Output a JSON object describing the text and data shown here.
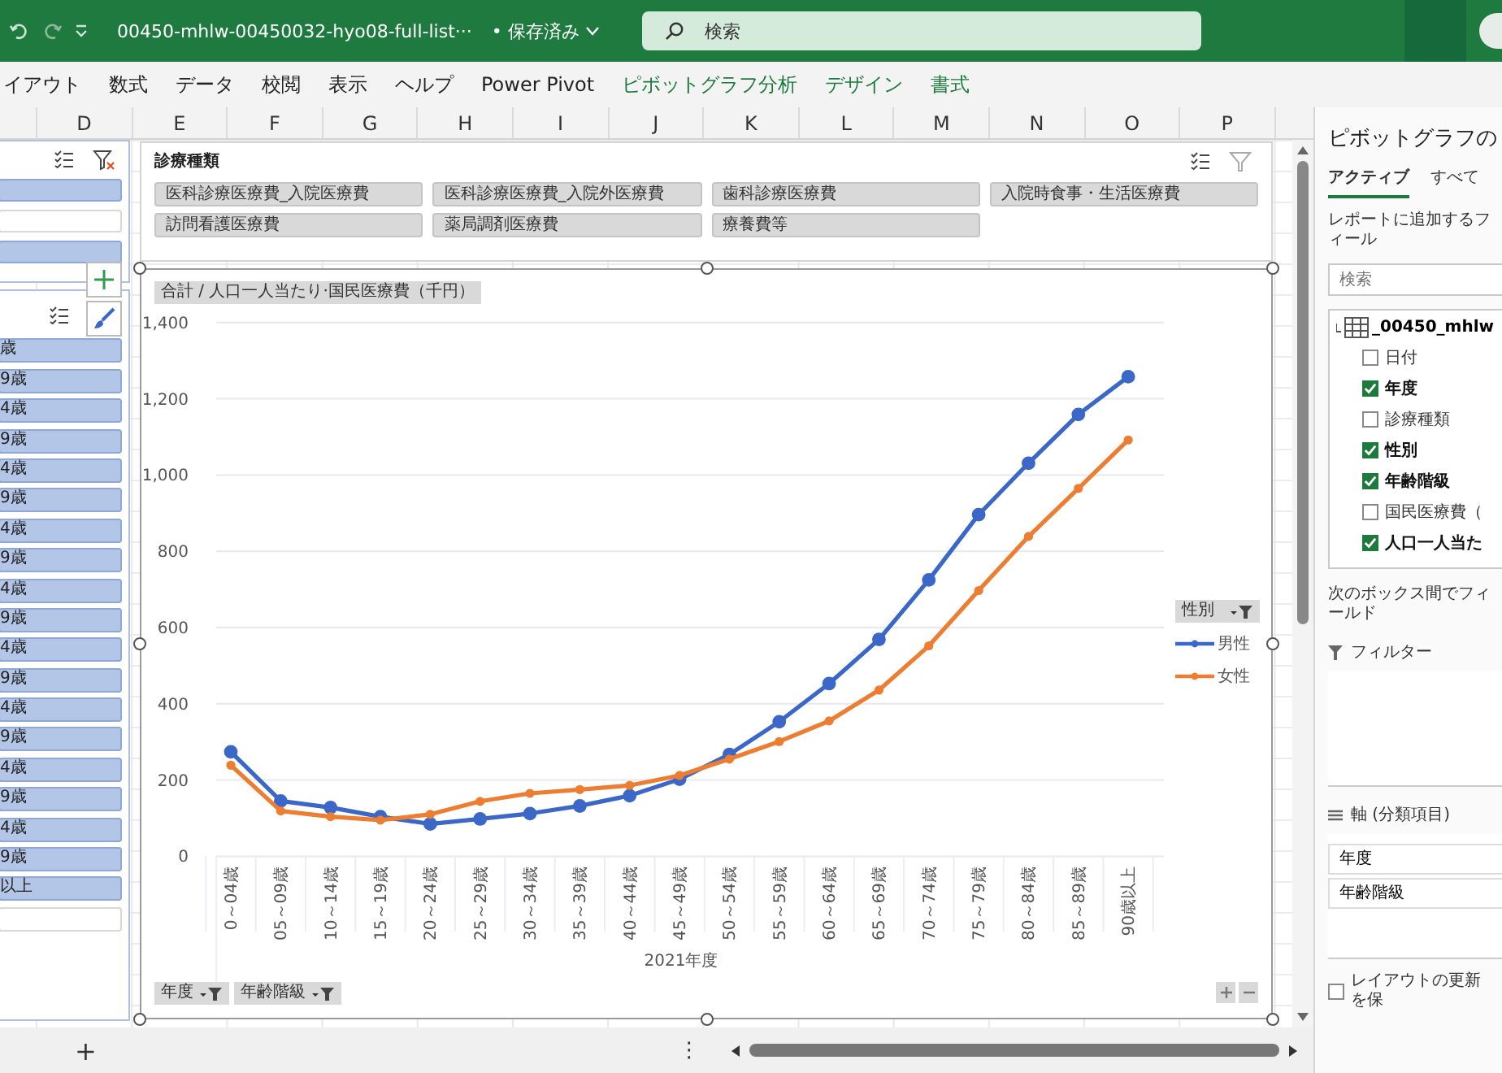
{
  "title_bar": {
    "file_name": "00450-mhlw-00450032-hyo08-full-list···",
    "save_status": "• 保存済み",
    "search_placeholder": "検索"
  },
  "ribbon_tabs": [
    {
      "label": "イアウト",
      "kind": "normal"
    },
    {
      "label": "数式",
      "kind": "normal"
    },
    {
      "label": "データ",
      "kind": "normal"
    },
    {
      "label": "校閲",
      "kind": "normal"
    },
    {
      "label": "表示",
      "kind": "normal"
    },
    {
      "label": "ヘルプ",
      "kind": "normal"
    },
    {
      "label": "Power Pivot",
      "kind": "normal"
    },
    {
      "label": "ピボットグラフ分析",
      "kind": "contextual"
    },
    {
      "label": "デザイン",
      "kind": "contextual"
    },
    {
      "label": "書式",
      "kind": "contextual"
    }
  ],
  "column_headers": [
    "D",
    "E",
    "F",
    "G",
    "H",
    "I",
    "J",
    "K",
    "L",
    "M",
    "N",
    "O",
    "P"
  ],
  "upper_left_slicer": {
    "items": [
      {
        "selected": true
      },
      {
        "selected": false
      },
      {
        "selected": true
      }
    ]
  },
  "age_slicer": {
    "items": [
      {
        "label": "歳",
        "selected": true
      },
      {
        "label": "9歳",
        "selected": true
      },
      {
        "label": "4歳",
        "selected": true
      },
      {
        "label": "9歳",
        "selected": true
      },
      {
        "label": "4歳",
        "selected": true
      },
      {
        "label": "9歳",
        "selected": true
      },
      {
        "label": "4歳",
        "selected": true
      },
      {
        "label": "9歳",
        "selected": true
      },
      {
        "label": "4歳",
        "selected": true
      },
      {
        "label": "9歳",
        "selected": true
      },
      {
        "label": "4歳",
        "selected": true
      },
      {
        "label": "9歳",
        "selected": true
      },
      {
        "label": "4歳",
        "selected": true
      },
      {
        "label": "9歳",
        "selected": true
      },
      {
        "label": "4歳",
        "selected": true
      },
      {
        "label": "9歳",
        "selected": true
      },
      {
        "label": "4歳",
        "selected": true
      },
      {
        "label": "9歳",
        "selected": true
      },
      {
        "label": "以上",
        "selected": true
      },
      {
        "selected": false
      }
    ]
  },
  "category_slicer": {
    "title": "診療種類",
    "items": [
      {
        "label": "医科診療医療費_入院医療費",
        "selected": false
      },
      {
        "label": "医科診療医療費_入院外医療費",
        "selected": false
      },
      {
        "label": "歯科診療医療費",
        "selected": false
      },
      {
        "label": "入院時食事・生活医療費",
        "selected": false
      },
      {
        "label": "訪問看護医療費",
        "selected": false
      },
      {
        "label": "薬局調剤医療費",
        "selected": false
      },
      {
        "label": "療養費等",
        "selected": false
      }
    ]
  },
  "chart": {
    "value_field_button": "合計 / 人口一人当たり·国民医療費（千円）",
    "axis_field_buttons": [
      "年度",
      "年齢階級"
    ],
    "legend_field_button": "性別",
    "chart_data": {
      "type": "line",
      "xlabel": "2021年度",
      "categories": [
        "0～04歳",
        "05～09歳",
        "10～14歳",
        "15～19歳",
        "20～24歳",
        "25～29歳",
        "30～34歳",
        "35～39歳",
        "40～44歳",
        "45～49歳",
        "50～54歳",
        "55～59歳",
        "60～64歳",
        "65～69歳",
        "70～74歳",
        "75～79歳",
        "80～84歳",
        "85～89歳",
        "90歳以上"
      ],
      "grid": true,
      "series": [
        {
          "name": "男性",
          "color": "#3a67c8",
          "marker": "circle",
          "values": [
            274,
            145,
            128,
            104,
            85,
            98,
            112,
            132,
            159,
            202,
            267,
            353,
            453,
            569,
            725,
            896,
            1031,
            1159,
            1258
          ]
        },
        {
          "name": "女性",
          "color": "#ed7d31",
          "marker": "circle",
          "values": [
            239,
            119,
            104,
            95,
            110,
            144,
            165,
            175,
            186,
            212,
            255,
            301,
            355,
            436,
            552,
            697,
            839,
            965,
            1092
          ]
        }
      ],
      "ylim": [
        0,
        1400
      ],
      "yticks": [
        {
          "value": 0,
          "label": "0"
        },
        {
          "value": 200,
          "label": "200"
        },
        {
          "value": 400,
          "label": "400"
        },
        {
          "value": 600,
          "label": "600"
        },
        {
          "value": 800,
          "label": "800"
        },
        {
          "value": 1000,
          "label": "1,000"
        },
        {
          "value": 1200,
          "label": "1,200"
        },
        {
          "value": 1400,
          "label": "1,400"
        }
      ]
    }
  },
  "field_pane": {
    "title": "ピボットグラフの",
    "tabs": [
      {
        "label": "アクティブ",
        "selected": true
      },
      {
        "label": "すべて",
        "selected": false
      }
    ],
    "instruction": "レポートに追加するフィール",
    "search_placeholder": "検索",
    "table_name": "_00450_mhlw",
    "fields": [
      {
        "label": "日付",
        "checked": false
      },
      {
        "label": "年度",
        "checked": true
      },
      {
        "label": "診療種類",
        "checked": false
      },
      {
        "label": "性別",
        "checked": true
      },
      {
        "label": "年齢階級",
        "checked": true
      },
      {
        "label": "国民医療費（",
        "checked": false
      },
      {
        "label": "人口一人当た",
        "checked": true
      }
    ],
    "drag_hint": "次のボックス間でフィールド",
    "filters_label": "フィルター",
    "axis_label": "軸 (分類項目)",
    "axis_items": [
      "年度",
      "年齢階級"
    ],
    "defer_label": "レイアウトの更新を保",
    "defer_checked": false
  },
  "sheet_bar": {
    "add_sheet": "+",
    "more": "⋮"
  }
}
